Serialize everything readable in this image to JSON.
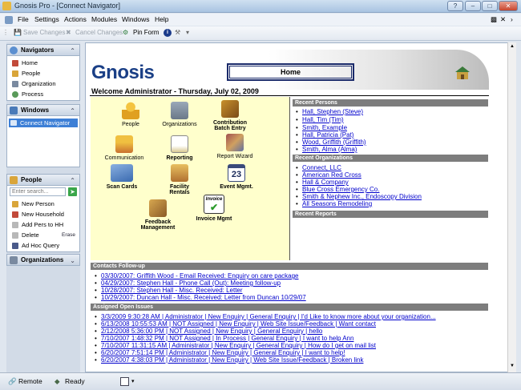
{
  "window": {
    "title": "Gnosis Pro - [Connect Navigator]"
  },
  "menu": [
    "File",
    "Settings",
    "Actions",
    "Modules",
    "Windows",
    "Help"
  ],
  "toolbar": {
    "save": "Save Changes",
    "cancel": "Cancel Changes",
    "pin": "Pin Form"
  },
  "navigators": {
    "header": "Navigators",
    "items": [
      "Home",
      "People",
      "Organization",
      "Process"
    ]
  },
  "windows": {
    "header": "Windows",
    "items": [
      "Connect Navigator"
    ]
  },
  "people": {
    "header": "People",
    "search_placeholder": "Enter search...",
    "actions": [
      "New Person",
      "New Household",
      "Add Pers to HH",
      "Delete",
      "Ad Hoc Query"
    ],
    "erase": "Erase"
  },
  "organizations": {
    "header": "Organizations"
  },
  "main": {
    "logo": "Gnosis",
    "home": "Home",
    "welcome": "Welcome Administrator - Thursday, July 02, 2009",
    "tiles": [
      {
        "label": "People",
        "bold": false
      },
      {
        "label": "Organizations",
        "bold": false
      },
      {
        "label": "Contribution Batch Entry",
        "bold": true
      },
      {
        "label": "Communication",
        "bold": false
      },
      {
        "label": "Reporting",
        "bold": true
      },
      {
        "label": "Report Wizard",
        "bold": false
      },
      {
        "label": "Scan Cards",
        "bold": true
      },
      {
        "label": "Facility Rentals",
        "bold": true
      },
      {
        "label": "Event Mgmt.",
        "bold": true
      },
      {
        "label": "Feedback Management",
        "bold": true
      },
      {
        "label": "Invoice Mgmt",
        "bold": true
      }
    ],
    "recent_persons": {
      "header": "Recent Persons",
      "items": [
        "Hall, Stephen (Steve)",
        "Hall, Tim (Tim)",
        "Smith, Example",
        "Hall, Patricia (Pat)",
        "Wood, Griffith (Griffith)",
        "Smith, Alma (Alma)"
      ]
    },
    "recent_orgs": {
      "header": "Recent Organizations",
      "items": [
        "Connect, LLC",
        "American Red Cross",
        "Hall & Company",
        "Blue Cross Emergency Co.",
        "Smith & Nephew Inc., Endoscopy Division",
        "All Seasons Remodeling"
      ]
    },
    "recent_reports": {
      "header": "Recent Reports"
    },
    "contacts": {
      "header": "Contacts Follow-up",
      "items": [
        "03/30/2007: Griffith Wood - Email Received: Enquiry on care package",
        "04/29/2007: Stephen Hall - Phone Call (Out): Meeting follow-up",
        "10/28/2007: Stephen Hall - Misc. Received: Letter",
        "10/29/2007: Duncan Hall - Misc. Received: Letter from Duncan 10/29/07"
      ]
    },
    "issues": {
      "header": "Assigned Open Issues",
      "items": [
        "3/3/2009 9:30:28 AM | Administrator | New Enquiry | General Enquiry | I'd Like to know more about your organization...",
        "6/13/2008 10:55:53 AM | NOT Assigned | New Enquiry | Web Site Issue/Feedback | Want contact",
        "2/12/2008 5:36:00 PM | NOT Assigned | New Enquiry | General Enquiry | hello",
        "7/10/2007 1:48:32 PM | NOT Assigned | In Process | General Enquiry | I want to help Ann",
        "7/10/2007 11:31:15 AM | Administrator | New Enquiry | General Enquiry | How do I get on mail list",
        "6/20/2007 7:51:14 PM | Administrator | New Enquiry | General Enquiry | I want to help!",
        "6/20/2007 4:38:03 PM | Administrator | New Enquiry | Web Site Issue/Feedback | Broken link"
      ]
    }
  },
  "status": {
    "remote": "Remote",
    "ready": "Ready"
  },
  "colors": {
    "accent": "#1a3f86",
    "panel": "#ffffcc",
    "link": "#0000cc",
    "header_gray": "#7d7d7d"
  }
}
